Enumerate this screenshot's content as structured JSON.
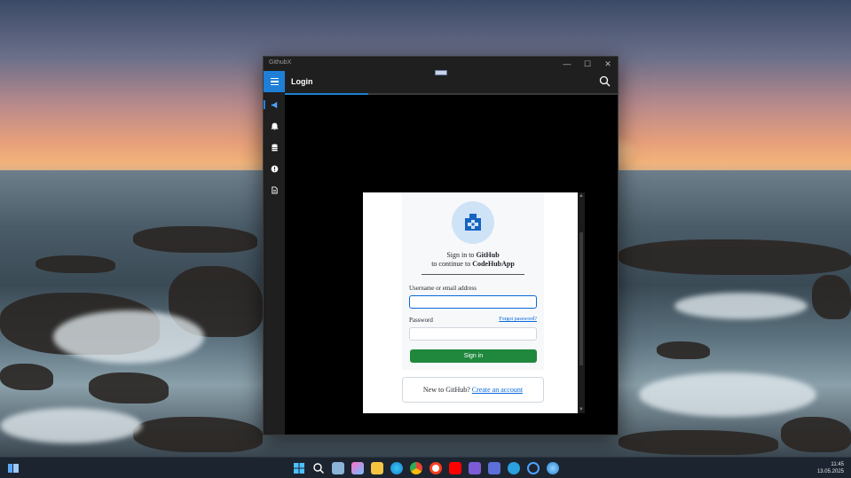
{
  "window": {
    "title": "GithubX"
  },
  "window_controls": {
    "minimize": "—",
    "maximize": "☐",
    "close": "✕"
  },
  "header": {
    "title": "Login"
  },
  "progress": {
    "fraction": 0.25
  },
  "sidebar": {
    "items": [
      {
        "name": "news-icon",
        "active": true
      },
      {
        "name": "notifications-icon",
        "active": false
      },
      {
        "name": "repositories-icon",
        "active": false
      },
      {
        "name": "issues-icon",
        "active": false
      },
      {
        "name": "gists-icon",
        "active": false
      }
    ]
  },
  "login": {
    "heading_prefix": "Sign in to ",
    "heading_brand": "GitHub",
    "sub_prefix": "to continue to ",
    "sub_app": "CodeHubApp",
    "username_label": "Username or email address",
    "username_value": "",
    "password_label": "Password",
    "password_value": "",
    "forgot_link": "Forgot password?",
    "signin_button": "Sign in",
    "new_prompt": "New to GitHub? ",
    "create_link": "Create an account"
  },
  "taskbar": {
    "time": "11:45",
    "date": "13.05.2025"
  },
  "colors": {
    "accent": "#1f7fd6",
    "github_green": "#1f883d",
    "link": "#0969da"
  }
}
